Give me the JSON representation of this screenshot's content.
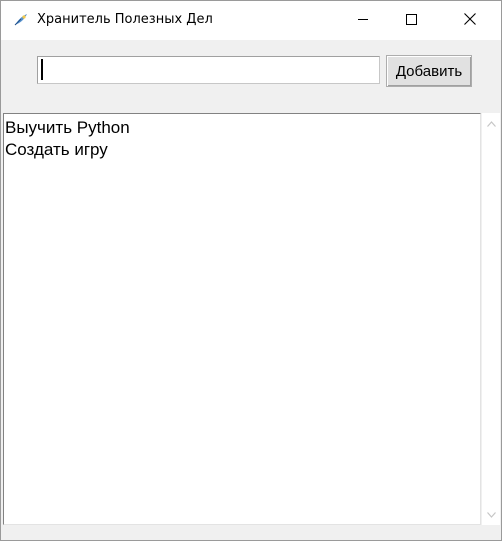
{
  "window": {
    "title": "Хранитель Полезных Дел",
    "icon": "feather-app-icon"
  },
  "caption_buttons": {
    "minimize_icon": "minimize-icon",
    "maximize_icon": "maximize-icon",
    "close_icon": "close-icon"
  },
  "entry": {
    "value": "",
    "placeholder": ""
  },
  "add_button": {
    "label": "Добавить"
  },
  "list": {
    "items": [
      {
        "label": "Выучить Python"
      },
      {
        "label": "Создать игру"
      }
    ]
  },
  "colors": {
    "window_bg": "#f0f0f0",
    "titlebar_bg": "#ffffff",
    "button_bg": "#e1e1e1",
    "list_bg": "#ffffff"
  }
}
